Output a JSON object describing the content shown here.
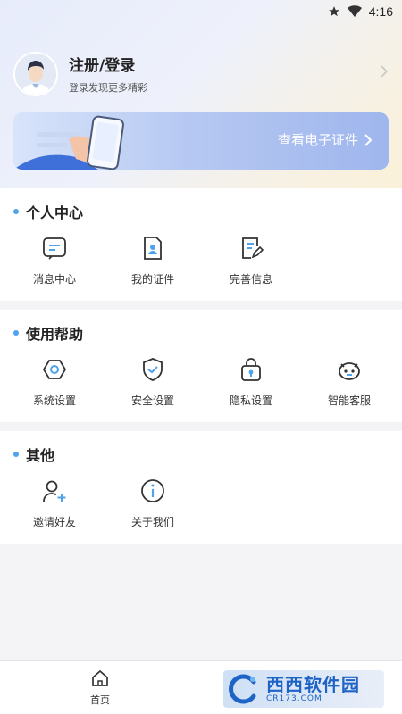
{
  "status_bar": {
    "time": "4:16"
  },
  "profile": {
    "title": "注册/登录",
    "subtitle": "登录发现更多精彩"
  },
  "banner": {
    "label": "查看电子证件"
  },
  "sections": [
    {
      "title": "个人中心",
      "items": [
        {
          "label": "消息中心",
          "icon": "message-icon"
        },
        {
          "label": "我的证件",
          "icon": "certificate-icon"
        },
        {
          "label": "完善信息",
          "icon": "edit-info-icon"
        }
      ]
    },
    {
      "title": "使用帮助",
      "items": [
        {
          "label": "系统设置",
          "icon": "settings-icon"
        },
        {
          "label": "安全设置",
          "icon": "shield-icon"
        },
        {
          "label": "隐私设置",
          "icon": "lock-icon"
        },
        {
          "label": "智能客服",
          "icon": "robot-icon"
        }
      ]
    },
    {
      "title": "其他",
      "items": [
        {
          "label": "邀请好友",
          "icon": "add-user-icon"
        },
        {
          "label": "关于我们",
          "icon": "info-icon"
        }
      ]
    }
  ],
  "bottom_nav": {
    "home_label": "首页"
  },
  "watermark": {
    "brand": "西西软件园",
    "url": "CR173.COM"
  },
  "colors": {
    "accent": "#4ea3ec",
    "icon_stroke": "#333333"
  }
}
